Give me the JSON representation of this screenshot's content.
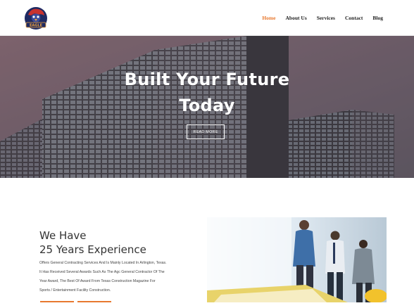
{
  "logo": {
    "icon": "eagle-mascot-logo",
    "text": "EAGLE"
  },
  "nav": {
    "items": [
      "Home",
      "About Us",
      "Services",
      "Contact",
      "Blog"
    ],
    "active": "Home",
    "accent_color": "#e8792f"
  },
  "hero": {
    "title_line1": "Built Your Future",
    "title_line2": "Today",
    "button_label": "READ MORE"
  },
  "about": {
    "heading_line1": "We Have",
    "heading_line2": "25 Years Experience",
    "paragraph_lines": [
      "Offers General Contracting Services And Is Mainly Located In Arlington, Texas.",
      "It Has Received Several Awards Such As The Agc General Contractor Of The",
      "Year Award, The Best Of Award From Texas Construction Magazine For",
      "Sports / Entertainment Facility Construction."
    ]
  }
}
